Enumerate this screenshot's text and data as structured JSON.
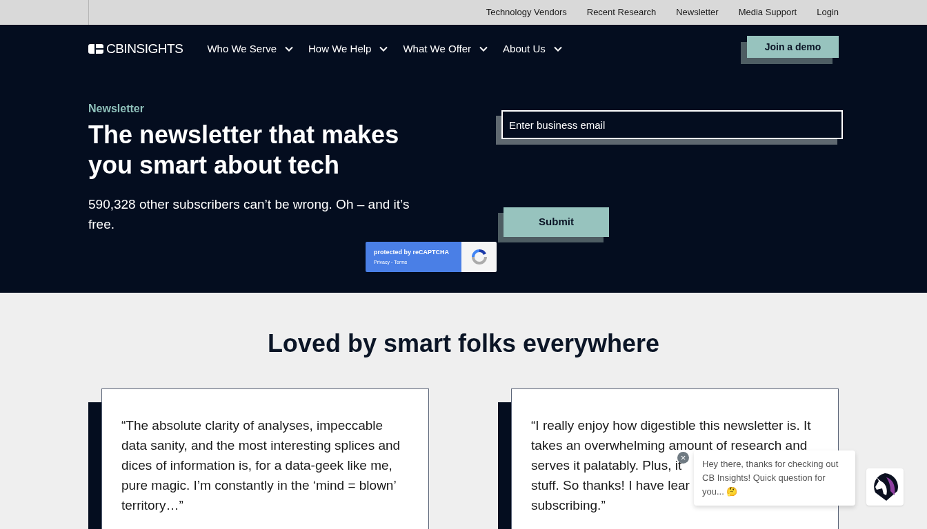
{
  "top_links": [
    "Technology Vendors",
    "Recent Research",
    "Newsletter",
    "Media Support",
    "Login"
  ],
  "logo": "**CB**INSIGHTS",
  "nav": [
    "Who We Serve",
    "How We Help",
    "What We Offer",
    "About Us"
  ],
  "demo_button": "Join a demo",
  "hero": {
    "eyebrow": "Newsletter",
    "title": "The newsletter that makes you smart about tech",
    "subtitle": "590,328 other subscribers can’t be wrong. Oh – and it’s free.",
    "email": {
      "placeholder": "Enter business email"
    },
    "submit": "Submit",
    "recaptcha": {
      "title": "protected by reCAPTCHA",
      "links": [
        "Privacy",
        "Terms"
      ],
      "separator": "-"
    }
  },
  "section_title": "Loved by smart folks everywhere",
  "testimonials": [
    {
      "lines": [
        "“The absolute clarity of analyses, impeccable",
        "data sanity, and the most interesting splices and",
        "dices of information is, for a data-geek like me,",
        "pure magic. I’m constantly in the ‘mind = blown’",
        "territory…”"
      ]
    },
    {
      "lines": [
        "“I really enjoy how digestible this newsletter is. It",
        "takes an overwhelming amount of research and",
        "serves it palatably. Plus, it",
        "stuff. So thanks! I have lear",
        "subscribing.”"
      ]
    }
  ],
  "chat": {
    "message": "Hey there, thanks for checking out CB Insights! Quick question for you... 🤔",
    "close": "×"
  }
}
